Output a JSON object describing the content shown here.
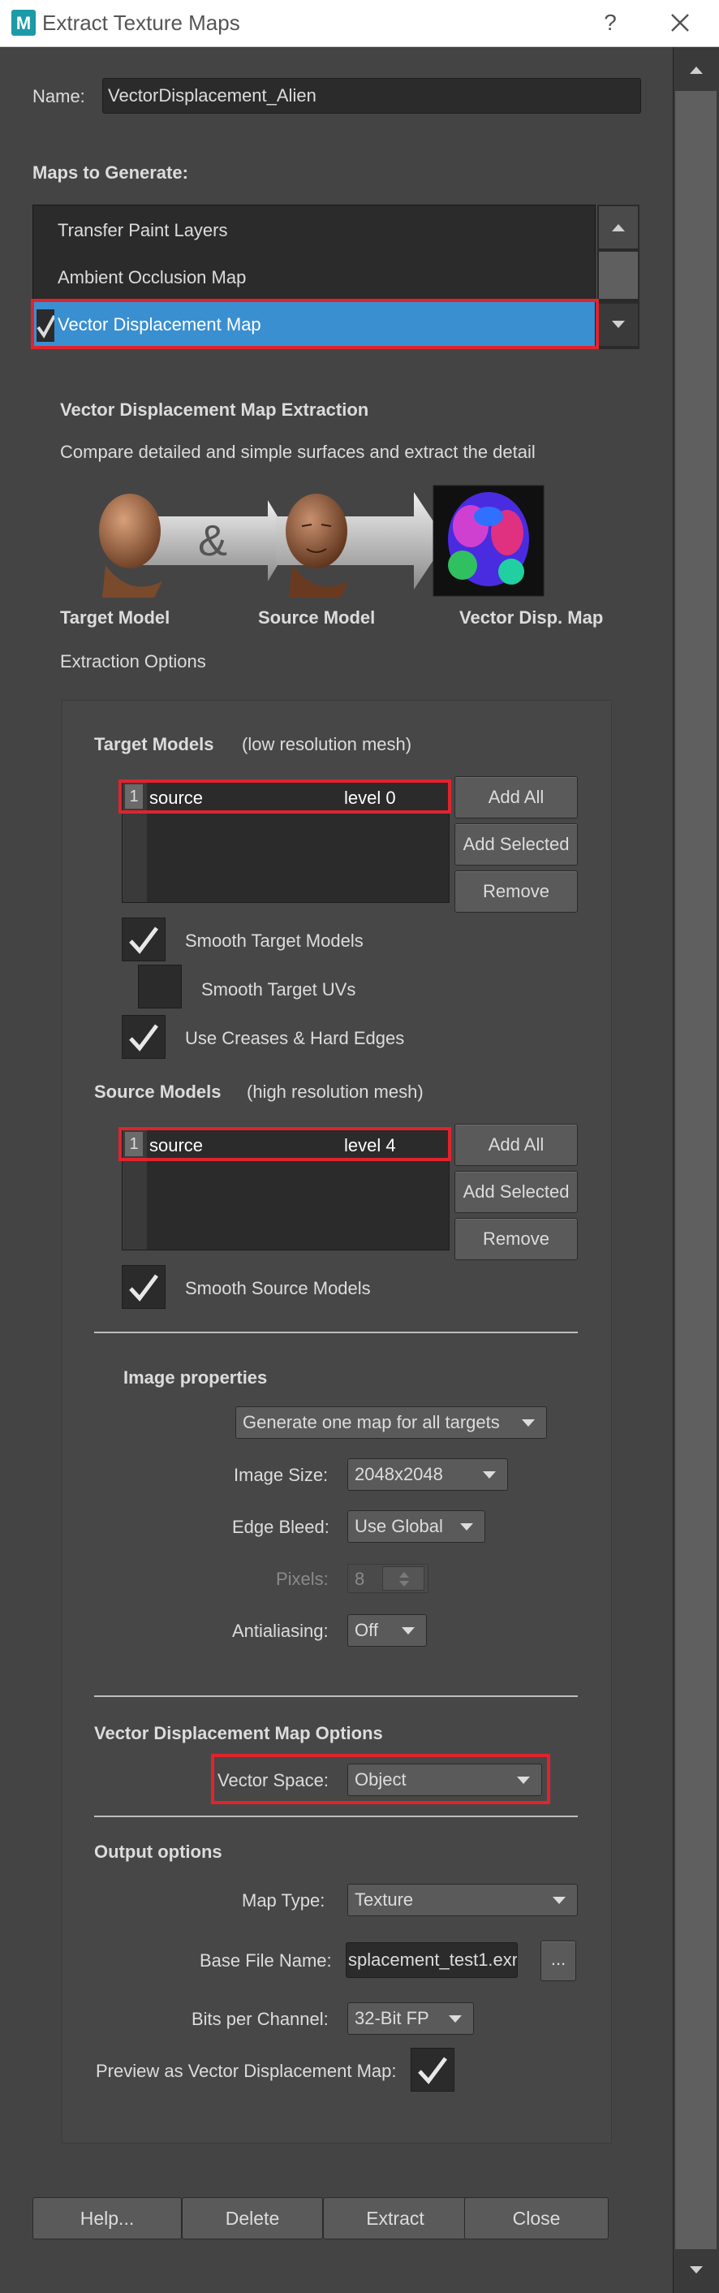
{
  "window": {
    "title": "Extract Texture Maps",
    "help": "?"
  },
  "name_field": {
    "label": "Name:",
    "value": "VectorDisplacement_Alien"
  },
  "maps": {
    "heading": "Maps to Generate:",
    "items": [
      "Transfer Paint Layers",
      "Ambient Occlusion Map",
      "Vector Displacement Map"
    ],
    "selected": "Vector Displacement Map"
  },
  "extraction": {
    "heading": "Vector Displacement Map Extraction",
    "description": "Compare detailed and simple surfaces and extract the detail",
    "ampersand": "&",
    "captions": [
      "Target Model",
      "Source Model",
      "Vector Disp. Map"
    ],
    "options_label": "Extraction Options"
  },
  "target_models": {
    "heading": "Target Models",
    "subheading": "(low resolution mesh)",
    "row": {
      "index": "1",
      "name": "source",
      "level": "level 0"
    },
    "buttons": [
      "Add All",
      "Add Selected",
      "Remove"
    ],
    "checks": [
      {
        "label": "Smooth Target Models",
        "checked": true
      },
      {
        "label": "Smooth Target UVs",
        "checked": false
      },
      {
        "label": "Use Creases & Hard Edges",
        "checked": true
      }
    ]
  },
  "source_models": {
    "heading": "Source Models",
    "subheading": "(high resolution mesh)",
    "row": {
      "index": "1",
      "name": "source",
      "level": "level 4"
    },
    "buttons": [
      "Add All",
      "Add Selected",
      "Remove"
    ],
    "checks": [
      {
        "label": "Smooth Source Models",
        "checked": true
      }
    ]
  },
  "image_properties": {
    "heading": "Image properties",
    "map_mode": "Generate one map for all targets",
    "image_size_label": "Image Size:",
    "image_size": "2048x2048",
    "edge_bleed_label": "Edge Bleed:",
    "edge_bleed": "Use Global",
    "pixels_label": "Pixels:",
    "pixels": "8",
    "antialiasing_label": "Antialiasing:",
    "antialiasing": "Off"
  },
  "vd_options": {
    "heading": "Vector Displacement Map Options",
    "vector_space_label": "Vector Space:",
    "vector_space": "Object"
  },
  "output": {
    "heading": "Output options",
    "map_type_label": "Map Type:",
    "map_type": "Texture",
    "base_file_label": "Base File Name:",
    "base_file": "splacement_test1.exr",
    "browse": "...",
    "bits_label": "Bits per Channel:",
    "bits": "32-Bit FP",
    "preview_label": "Preview as Vector Displacement Map:",
    "preview_checked": true
  },
  "footer": {
    "buttons": [
      "Help...",
      "Delete",
      "Extract",
      "Close"
    ]
  },
  "colors": {
    "selection": "#3a8fd1",
    "highlight": "#e0232e",
    "background": "#444444"
  },
  "icons": [
    "maya-app-icon",
    "close-icon",
    "scroll-up-icon",
    "scroll-down-icon",
    "checkmark-icon",
    "dropdown-arrow-icon"
  ]
}
